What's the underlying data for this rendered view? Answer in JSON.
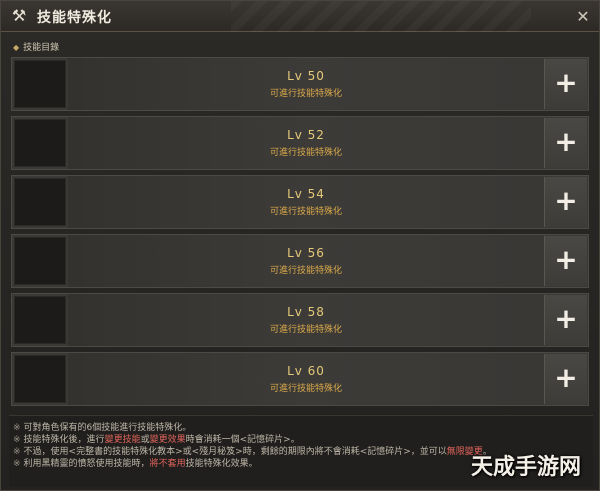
{
  "window": {
    "title": "技能特殊化",
    "title_icon": "crossed-hammers-icon",
    "close_icon": "close-icon",
    "close_glyph": "✕"
  },
  "section": {
    "label": "技能目錄"
  },
  "rows": [
    {
      "level": "Lv 50",
      "desc": "可進行技能特殊化",
      "button": "+"
    },
    {
      "level": "Lv 52",
      "desc": "可進行技能特殊化",
      "button": "+"
    },
    {
      "level": "Lv 54",
      "desc": "可進行技能特殊化",
      "button": "+"
    },
    {
      "level": "Lv 56",
      "desc": "可進行技能特殊化",
      "button": "+"
    },
    {
      "level": "Lv 58",
      "desc": "可進行技能特殊化",
      "button": "+"
    },
    {
      "level": "Lv 60",
      "desc": "可進行技能特殊化",
      "button": "+"
    }
  ],
  "notes": {
    "mark": "※",
    "n1": "可對角色保有的6個技能進行技能特殊化。",
    "n2_a": "技能特殊化後，進行",
    "n2_b": "變更技能",
    "n2_c": "或",
    "n2_d": "變更效果",
    "n2_e": "時會消耗一個<記憶碎片>。",
    "n3_a": "不過，使用<完整書的技能特殊化教本>或<殘月秘笈>時，剩餘的期限內將不會消耗<記憶碎片>，並可以",
    "n3_b": "無限變更",
    "n3_c": "。",
    "n4_a": "利用黑精靈的憤怒使用技能時，",
    "n4_b": "將不套用",
    "n4_c": "技能特殊化效果。"
  },
  "watermark": "天成手游网",
  "colors": {
    "accent_gold": "#e5c979",
    "desc_orange": "#d9a94a",
    "highlight_red": "#e0645c"
  }
}
